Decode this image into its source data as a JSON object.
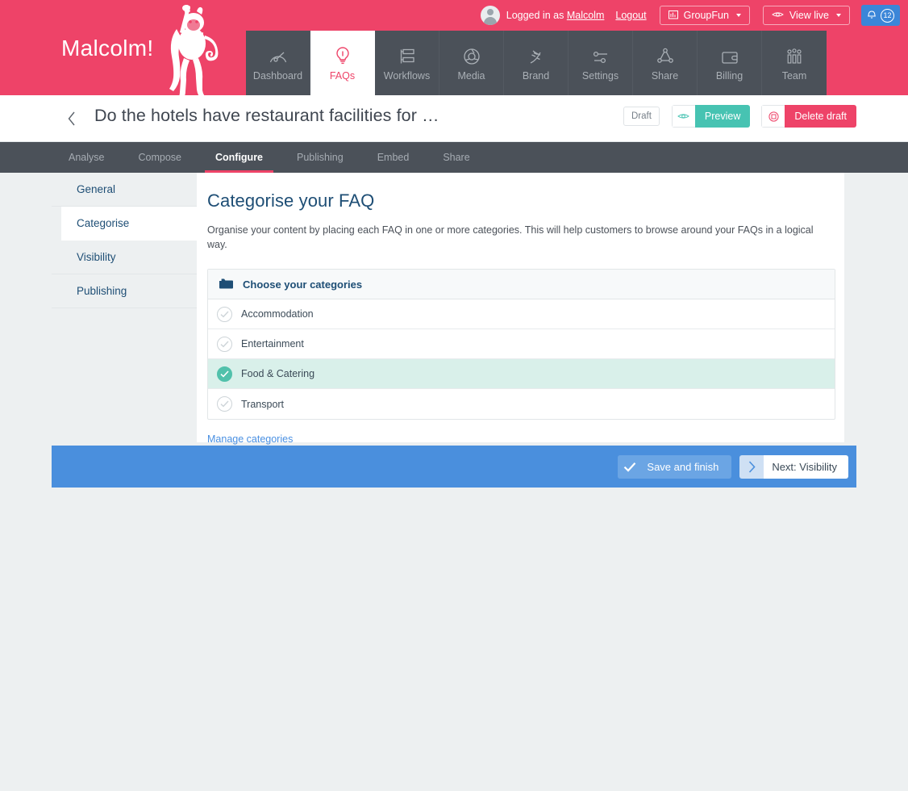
{
  "brand": {
    "name": "Malcolm!",
    "logo_icon": "monkey-logo"
  },
  "userbar": {
    "avatar_icon": "user-avatar-icon",
    "logged_in_prefix": "Logged in as",
    "username": "Malcolm",
    "logout_label": "Logout",
    "account": {
      "label": "GroupFun",
      "icon": "chart-bars-icon"
    },
    "view_live": {
      "label": "View live",
      "icon": "eye-icon"
    },
    "notifications": {
      "icon": "bell-icon",
      "count": "12",
      "color": "#3b86d8"
    }
  },
  "mainnav": {
    "items": [
      {
        "label": "Dashboard",
        "icon": "speedometer-icon",
        "active": false
      },
      {
        "label": "FAQs",
        "icon": "lightbulb-icon",
        "active": true
      },
      {
        "label": "Workflows",
        "icon": "workflow-icon",
        "active": false
      },
      {
        "label": "Media",
        "icon": "aperture-icon",
        "active": false
      },
      {
        "label": "Brand",
        "icon": "dna-icon",
        "active": false
      },
      {
        "label": "Settings",
        "icon": "sliders-icon",
        "active": false
      },
      {
        "label": "Share",
        "icon": "share-nodes-icon",
        "active": false
      },
      {
        "label": "Billing",
        "icon": "wallet-icon",
        "active": false
      },
      {
        "label": "Team",
        "icon": "team-icon",
        "active": false
      }
    ]
  },
  "titlebar": {
    "back_icon": "chevron-left-icon",
    "title": "Do the hotels have restaurant facilities for …",
    "status_badge": "Draft",
    "preview_button": {
      "label": "Preview",
      "icon": "eye-icon",
      "color": "#47c3b2"
    },
    "delete_button": {
      "label": "Delete draft",
      "icon": "delete-circle-icon",
      "color": "#ee4368"
    }
  },
  "subnav": {
    "items": [
      {
        "label": "Analyse",
        "active": false
      },
      {
        "label": "Compose",
        "active": false
      },
      {
        "label": "Configure",
        "active": true
      },
      {
        "label": "Publishing",
        "active": false
      },
      {
        "label": "Embed",
        "active": false
      },
      {
        "label": "Share",
        "active": false
      }
    ]
  },
  "sidebar": {
    "items": [
      {
        "label": "General",
        "active": false
      },
      {
        "label": "Categorise",
        "active": true
      },
      {
        "label": "Visibility",
        "active": false
      },
      {
        "label": "Publishing",
        "active": false
      }
    ]
  },
  "main": {
    "heading": "Categorise your FAQ",
    "description": "Organise your content by placing each FAQ in one or more categories. This will help customers to browse around your FAQs in a logical way.",
    "panel": {
      "header_label": "Choose your categories",
      "header_icon": "folder-icon",
      "categories": [
        {
          "label": "Accommodation",
          "selected": false
        },
        {
          "label": "Entertainment",
          "selected": false
        },
        {
          "label": "Food & Catering",
          "selected": true
        },
        {
          "label": "Transport",
          "selected": false
        }
      ]
    },
    "manage_link": "Manage categories"
  },
  "actionbar": {
    "background": "#4a8fdd",
    "save_button": {
      "label": "Save and finish",
      "icon": "check-icon"
    },
    "next_button": {
      "label": "Next: Visibility",
      "icon": "chevron-right-icon"
    }
  }
}
